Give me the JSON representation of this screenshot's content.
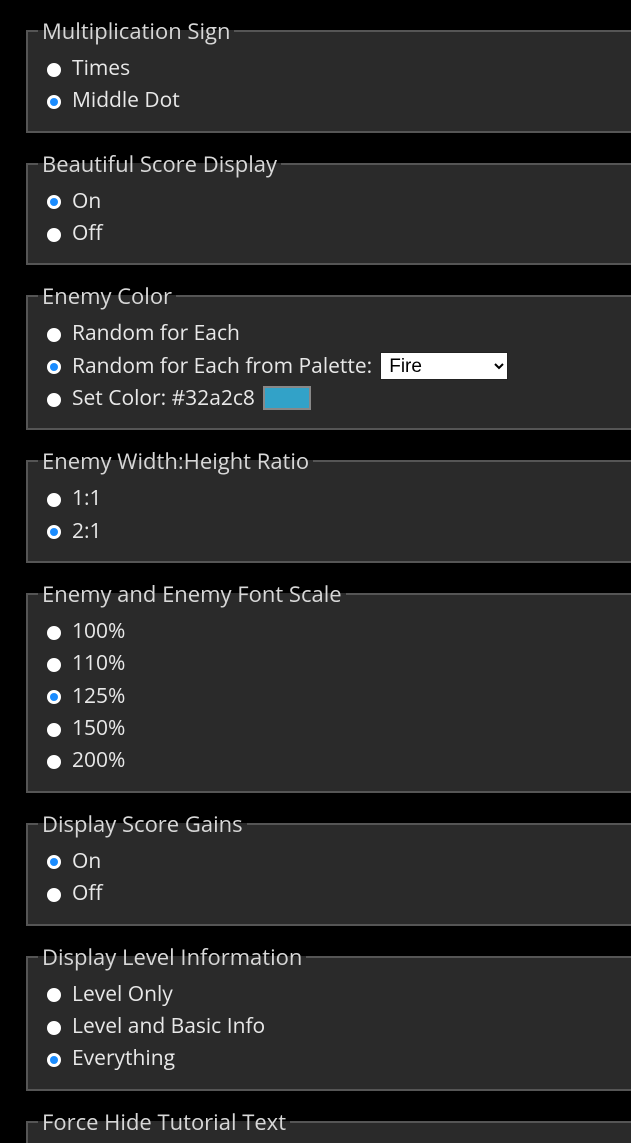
{
  "groups": {
    "mult_sign": {
      "legend": "Multiplication Sign",
      "options": {
        "times": "Times",
        "middle_dot": "Middle Dot"
      }
    },
    "score_display": {
      "legend": "Beautiful Score Display",
      "options": {
        "on": "On",
        "off": "Off"
      }
    },
    "enemy_color": {
      "legend": "Enemy Color",
      "options": {
        "random_each": "Random for Each",
        "random_palette_prefix": "Random for Each from Palette: ",
        "set_color_prefix": "Set Color: "
      },
      "palette_selected": "Fire",
      "set_color_hex": "#32a2c8"
    },
    "ratio": {
      "legend": "Enemy Width:Height Ratio",
      "options": {
        "r11": "1:1",
        "r21": "2:1"
      }
    },
    "font_scale": {
      "legend": "Enemy and Enemy Font Scale",
      "options": {
        "s100": "100%",
        "s110": "110%",
        "s125": "125%",
        "s150": "150%",
        "s200": "200%"
      }
    },
    "score_gains": {
      "legend": "Display Score Gains",
      "options": {
        "on": "On",
        "off": "Off"
      }
    },
    "level_info": {
      "legend": "Display Level Information",
      "options": {
        "level_only": "Level Only",
        "level_basic": "Level and Basic Info",
        "everything": "Everything"
      }
    },
    "force_hide_tutorial": {
      "legend": "Force Hide Tutorial Text"
    }
  }
}
